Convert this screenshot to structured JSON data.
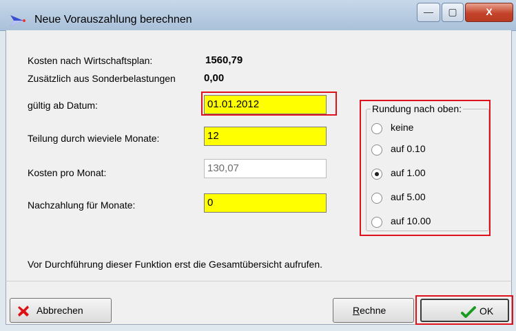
{
  "window": {
    "title": "Neue Vorauszahlung berechnen",
    "controls": [
      "—",
      "▢",
      "X"
    ]
  },
  "form": {
    "cost_plan_label": "Kosten nach Wirtschaftsplan:",
    "cost_plan_value": "1560,79",
    "extra_label": "Zusätzlich aus Sonderbelastungen",
    "extra_value": "0,00",
    "date_label": "gültig ab Datum:",
    "date_value": "01.01.2012",
    "months_label": "Teilung durch wieviele Monate:",
    "months_value": "12",
    "monthly_label": "Kosten pro Monat:",
    "monthly_value": "130,07",
    "backpay_label": "Nachzahlung für Monate:",
    "backpay_value": "0"
  },
  "rounding": {
    "legend": "Rundung nach oben:",
    "options": [
      {
        "label": "keine",
        "checked": false
      },
      {
        "label": "auf 0.10",
        "checked": false
      },
      {
        "label": "auf 1.00",
        "checked": true
      },
      {
        "label": "auf 5.00",
        "checked": false
      },
      {
        "label": "auf 10.00",
        "checked": false
      }
    ]
  },
  "notice": "Vor Durchführung dieser Funktion erst die Gesamtübersicht aufrufen.",
  "buttons": {
    "cancel": "Abbrechen",
    "calc_mnemonic": "R",
    "calc_rest": "echne",
    "ok": "OK"
  },
  "colors": {
    "highlight": "#ffff00",
    "annotation_red": "#e0101a"
  }
}
